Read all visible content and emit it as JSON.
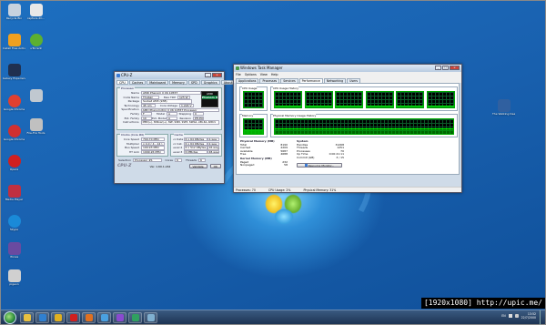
{
  "desktop": {
    "icons": [
      {
        "label": "Recycle Bin",
        "color": "#c8d2de"
      },
      {
        "label": "capture-2C...",
        "color": "#e8e8e8"
      },
      {
        "label": "Install Free Antivirus",
        "color": "#f0a020"
      },
      {
        "label": "uTorrent",
        "color": "#5cb030"
      },
      {
        "label": "Galaxy Experience",
        "color": "#203050"
      },
      {
        "label": "",
        "color": "#c0c8d0"
      },
      {
        "label": "Google Chrome",
        "color": "#e04030"
      },
      {
        "label": "Fire-Fox Tools",
        "color": "#c0c0c0"
      },
      {
        "label": "Google Chrome",
        "color": "#d03030"
      },
      {
        "label": "Opera",
        "color": "#d02020"
      },
      {
        "label": "Media Player",
        "color": "#c03040"
      },
      {
        "label": "Skype",
        "color": "#1a8ad8"
      },
      {
        "label": "iTunes",
        "color": "#6a4aa0"
      },
      {
        "label": "pigeon",
        "color": "#d0d0d0"
      }
    ],
    "right_icon": {
      "label": "The Walking Dead 1",
      "color": "#3060a0"
    }
  },
  "cpuz": {
    "title": "CPU-Z",
    "tabs": [
      "CPU",
      "Caches",
      "Mainboard",
      "Memory",
      "SPD",
      "Graphics",
      "About"
    ],
    "processor_label": "Processor",
    "fields": [
      {
        "l": "Name",
        "v": "AMD Phenom II X6 1055T"
      },
      {
        "l": "Code Name",
        "v": "Thuban"
      },
      {
        "l": "Package",
        "v": "Socket AM3 (938)"
      },
      {
        "l": "Technology",
        "v": "45 nm"
      }
    ],
    "max_tdp_label": "Max TDP",
    "max_tdp": "125 W",
    "core_voltage_label": "Core Voltage",
    "core_voltage": "1.224 V",
    "spec_label": "Specification",
    "spec": "AMD Phenom(tm) II X6 1055T Processor",
    "fam_rows": [
      {
        "l": "Family",
        "v": "F",
        "l2": "Model",
        "v2": "A",
        "l3": "Stepping",
        "v3": "0"
      },
      {
        "l": "Ext. Family",
        "v": "10",
        "l2": "Ext. Model",
        "v2": "A",
        "l3": "Revision",
        "v3": "PH-E0"
      }
    ],
    "instr_label": "Instructions",
    "instr": "MMX(+), 3DNow!(+), SSE, SSE2, SSE3, SSE4A, x86-64, AMD-V",
    "clocks_label": "Clocks (Core #0)",
    "clocks": [
      {
        "l": "Core Speed",
        "v": "799.70 MHz"
      },
      {
        "l": "Multiplier",
        "v": "x 4.0 ( 4 - 14 )"
      },
      {
        "l": "Bus Speed",
        "v": "199.93 MHz"
      },
      {
        "l": "HT Link",
        "v": "1999.26 MHz"
      }
    ],
    "cache_label": "Cache",
    "caches": [
      {
        "l": "L1 Data",
        "v": "6 x 64 KBytes",
        "w": "2-way"
      },
      {
        "l": "L1 Inst.",
        "v": "6 x 64 KBytes",
        "w": "2-way"
      },
      {
        "l": "Level 2",
        "v": "6 x 512 KBytes",
        "w": "16-way"
      },
      {
        "l": "Level 3",
        "v": "6 MBytes",
        "w": "48-way"
      }
    ],
    "selection_label": "Selection",
    "selection": "Processor #1",
    "cores_label": "Cores",
    "cores": "6",
    "threads_label": "Threads",
    "threads": "6",
    "logo": "CPU-Z",
    "version": "Ver. 1.60.1.x64",
    "validate": "Validate",
    "ok": "OK",
    "brand_top": "AMD",
    "brand_bottom": "Phenom II"
  },
  "taskmgr": {
    "title": "Windows Task Manager",
    "menu": [
      "File",
      "Options",
      "View",
      "Help"
    ],
    "tabs": [
      "Applications",
      "Processes",
      "Services",
      "Performance",
      "Networking",
      "Users"
    ],
    "active_tab": 3,
    "cpu_usage_label": "CPU Usage",
    "cpu_history_label": "CPU Usage History",
    "memory_label": "Memory",
    "phys_history_label": "Physical Memory Usage History",
    "cpu_usage_pct": 0.02,
    "core_loads": [
      0.08,
      0.05,
      0.06,
      0.04,
      0.07,
      0.05
    ],
    "mem_fill": 0.33,
    "phys_label": "Physical Memory (MB)",
    "phys": [
      {
        "l": "Total",
        "v": "8190"
      },
      {
        "l": "Cached",
        "v": "2209"
      },
      {
        "l": "Available",
        "v": "5687"
      },
      {
        "l": "Free",
        "v": "4688"
      }
    ],
    "kernel_label": "Kernel Memory (MB)",
    "kernel": [
      {
        "l": "Paged",
        "v": "232"
      },
      {
        "l": "Nonpaged",
        "v": "58"
      }
    ],
    "system_label": "System",
    "system": [
      {
        "l": "Handles",
        "v": "31268"
      },
      {
        "l": "Threads",
        "v": "1251"
      },
      {
        "l": "Processes",
        "v": "70"
      },
      {
        "l": "Up Time",
        "v": "0:00:21:11"
      },
      {
        "l": "Commit (GB)",
        "v": "3 / 15"
      }
    ],
    "resmon_btn": "Resource Monitor...",
    "status": {
      "processes": "Processes: 70",
      "cpu": "CPU Usage: 2%",
      "mem": "Physical Memory: 31%"
    }
  },
  "taskbar": {
    "apps": [
      {
        "name": "explorer",
        "color": "#e8c040"
      },
      {
        "name": "media",
        "color": "#3080d0"
      },
      {
        "name": "chrome",
        "color": "#e0b020"
      },
      {
        "name": "opera",
        "color": "#d02020"
      },
      {
        "name": "firefox",
        "color": "#e07020"
      },
      {
        "name": "messenger",
        "color": "#4aa0e0"
      },
      {
        "name": "cpuz",
        "color": "#8a4ad0"
      },
      {
        "name": "app",
        "color": "#30a060"
      },
      {
        "name": "taskmgr",
        "color": "#80b0d0"
      }
    ],
    "lang": "EN",
    "time": "13:52",
    "date": "22/7/2000"
  },
  "watermark": "[1920x1080] http://upic.me/"
}
